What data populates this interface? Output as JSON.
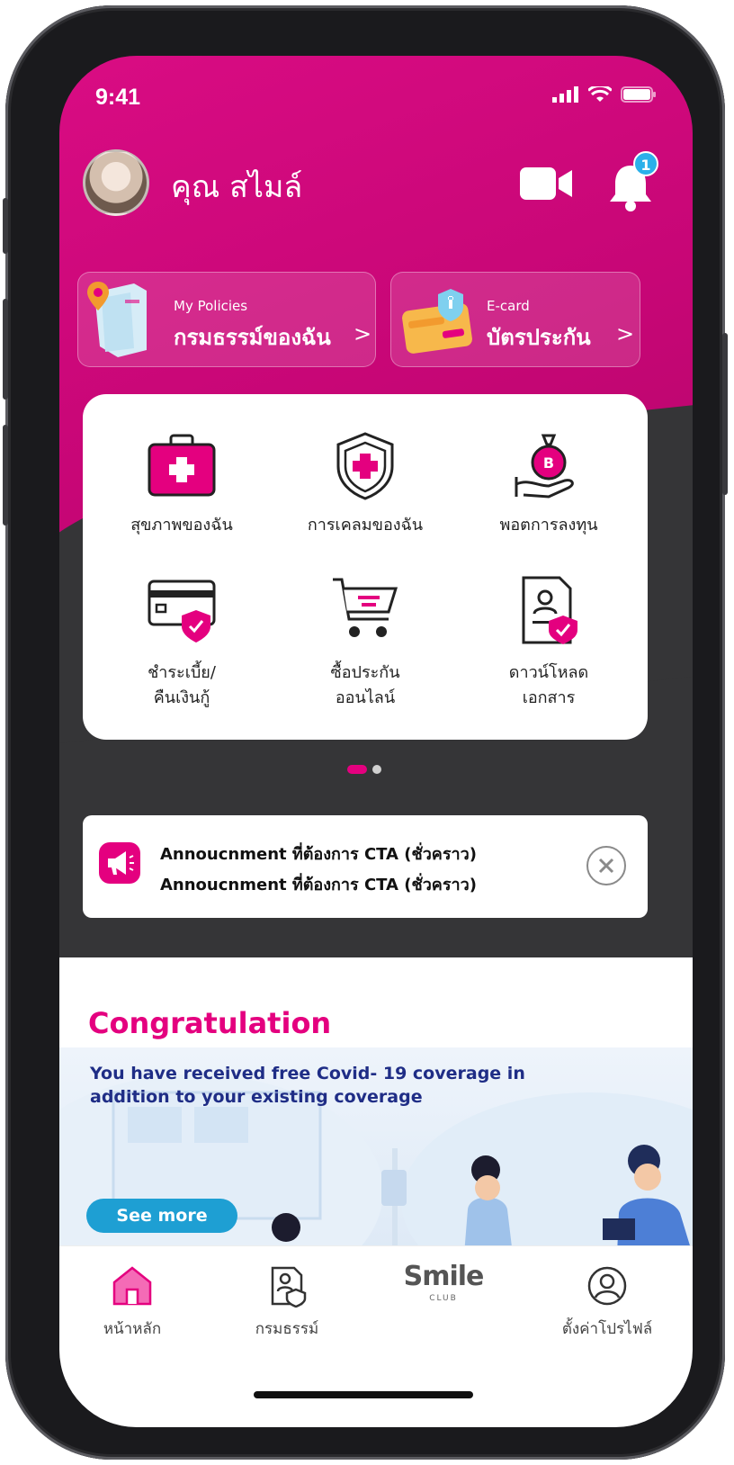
{
  "status_bar": {
    "time": "9:41"
  },
  "header": {
    "user_name": "คุณ สไมล์",
    "notification_count": "1"
  },
  "quick_cards": [
    {
      "subtitle": "My Policies",
      "title": "กรมธรรม์ของฉัน",
      "chevron": ">"
    },
    {
      "subtitle": "E-card",
      "title": "บัตรประกัน",
      "chevron": ">"
    }
  ],
  "menu": {
    "items": [
      {
        "label": "สุขภาพของฉัน",
        "icon": "medical-kit-icon"
      },
      {
        "label": "การเคลมของฉัน",
        "icon": "shield-cross-icon"
      },
      {
        "label": "พอตการลงทุน",
        "icon": "money-bag-hand-icon"
      },
      {
        "label_line1": "ชำระเบี้ย/",
        "label_line2": "คืนเงินกู้",
        "icon": "card-shield-icon"
      },
      {
        "label_line1": "ซื้อประกัน",
        "label_line2": "ออนไลน์",
        "icon": "cart-icon"
      },
      {
        "label_line1": "ดาวน์โหลด",
        "label_line2": "เอกสาร",
        "icon": "document-shield-icon"
      }
    ],
    "page_indicator": {
      "pages": 2,
      "active": 1
    }
  },
  "announcement": {
    "line1": "Annoucnment ที่ต้องการ CTA (ชั่วคราว)",
    "line2": "Annoucnment ที่ต้องการ CTA (ชั่วคราว)"
  },
  "promo": {
    "title": "Congratulation",
    "description": "You have received free Covid- 19 coverage in addition to your existing coverage",
    "button": "See more"
  },
  "bottom_nav": [
    {
      "label": "หน้าหลัก",
      "icon": "home-icon",
      "active": true
    },
    {
      "label": "กรมธรรม์",
      "icon": "policy-document-icon",
      "active": false
    },
    {
      "label": "Smile",
      "sub": "CLUB",
      "icon": "smile-club-logo",
      "active": false
    },
    {
      "label": "ตั้งค่าโปรไฟล์",
      "icon": "profile-icon",
      "active": false
    }
  ],
  "colors": {
    "brand_pink": "#e4007f",
    "accent_blue": "#1e9fd3",
    "navy_text": "#1f2d86",
    "dark_bg": "#353537"
  }
}
